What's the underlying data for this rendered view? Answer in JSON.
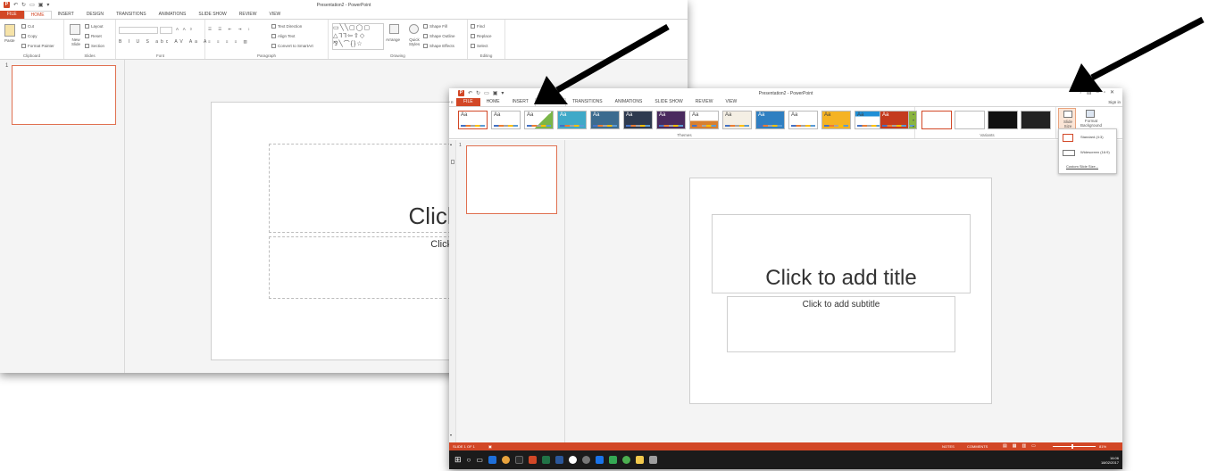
{
  "back_window": {
    "title": "Presentation2 - PowerPoint",
    "tabs": [
      "FILE",
      "HOME",
      "INSERT",
      "DESIGN",
      "TRANSITIONS",
      "ANIMATIONS",
      "SLIDE SHOW",
      "REVIEW",
      "VIEW"
    ],
    "clipboard": {
      "paste": "Paste",
      "cut": "Cut",
      "copy": "Copy",
      "format_painter": "Format Painter",
      "label": "Clipboard"
    },
    "slides_group": {
      "new_slide": "New Slide",
      "layout": "Layout",
      "reset": "Reset",
      "section": "Section",
      "label": "Slides"
    },
    "font_group": {
      "label": "Font"
    },
    "paragraph_group": {
      "text_direction": "Text Direction",
      "align_text": "Align Text",
      "convert_smartart": "Convert to SmartArt",
      "label": "Paragraph"
    },
    "drawing_group": {
      "arrange": "Arrange",
      "quick_styles": "Quick Styles",
      "shape_fill": "Shape Fill",
      "shape_outline": "Shape Outline",
      "shape_effects": "Shape Effects",
      "label": "Drawing"
    },
    "editing_group": {
      "find": "Find",
      "replace": "Replace",
      "select": "Select",
      "label": "Editing"
    },
    "slide_number": "1",
    "title_placeholder": "Click to a",
    "subtitle_placeholder": "Click to add"
  },
  "front_window": {
    "title": "Presentation2 - PowerPoint",
    "sign_in": "Sign in",
    "tabs": [
      "FILE",
      "HOME",
      "INSERT",
      "DESIGN",
      "TRANSITIONS",
      "ANIMATIONS",
      "SLIDE SHOW",
      "REVIEW",
      "VIEW"
    ],
    "themes_label": "Themes",
    "variants_label": "Variants",
    "slide_size": "Slide Size",
    "format_background": "Format Background",
    "dropdown": {
      "standard": "Standard (4:3)",
      "widescreen": "Widescreen (16:9)",
      "custom": "Custom Slide Size..."
    },
    "slide_number": "1",
    "title_placeholder": "Click to add title",
    "subtitle_placeholder": "Click to add subtitle",
    "status": {
      "slide": "SLIDE 1 OF 1",
      "notes": "NOTES",
      "comments": "COMMENTS",
      "zoom": "81%"
    },
    "clock": {
      "time": "16:06",
      "date": "18/02/2017"
    }
  },
  "colors": {
    "accent": "#d24726",
    "taskbar": "#1b1b1b"
  }
}
